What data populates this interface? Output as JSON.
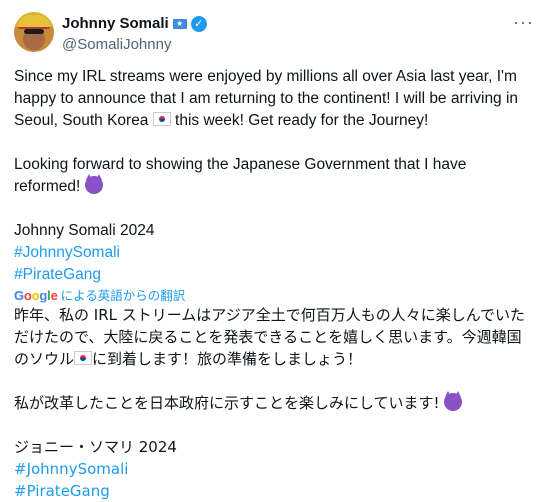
{
  "author": {
    "display_name": "Johnny Somali",
    "handle": "@SomaliJohnny"
  },
  "icons": {
    "more": "more-horizontal-icon",
    "verified": "verified-badge-icon",
    "flag": "somalia-flag-icon"
  },
  "colors": {
    "link": "#1d9bf0",
    "secondary": "#536471"
  },
  "tweet": {
    "para1_a": "Since my IRL streams were enjoyed by millions all over Asia last year, I'm happy to announce that I am returning to the continent! I will be arriving in Seoul, South Korea ",
    "para1_b": " this week! Get ready for the Journey!",
    "para2": "Looking forward to showing the Japanese Government that I have reformed! ",
    "signature": "Johnny Somali 2024",
    "hashtag1": "#JohnnySomali",
    "hashtag2": "#PirateGang"
  },
  "translation": {
    "label": "による英語からの翻訳",
    "para1_a": "昨年、私の IRL ストリームはアジア全土で何百万人もの人々に楽しんでいただけたので、大陸に戻ることを発表できることを嬉しく思います。今週韓国のソウル",
    "para1_b": "に到着します！旅の準備をしましょう！",
    "para2": "私が改革したことを日本政府に示すことを楽しみにしています! ",
    "signature": "ジョニー・ソマリ 2024",
    "hashtag1": "#JohnnySomali",
    "hashtag2": "#PirateGang"
  }
}
